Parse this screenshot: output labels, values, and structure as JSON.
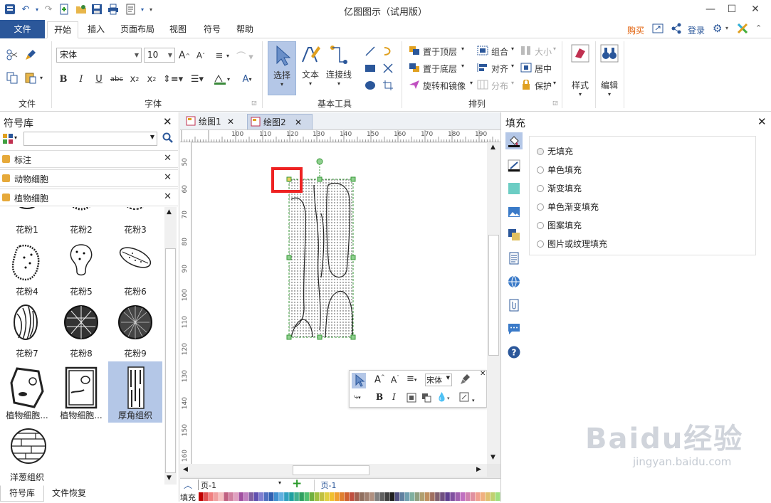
{
  "app": {
    "title": "亿图图示（试用版）"
  },
  "menu_tabs": [
    "文件",
    "开始",
    "插入",
    "页面布局",
    "视图",
    "符号",
    "帮助"
  ],
  "top_right": {
    "buy": "购买",
    "login": "登录"
  },
  "ribbon": {
    "groups": {
      "file": "文件",
      "font": "字体",
      "basic_tools": "基本工具",
      "arrange": "排列"
    },
    "font_name": "宋体",
    "font_size": "10",
    "buttons": {
      "select": "选择",
      "text": "文本",
      "connector": "连接线",
      "bring_front": "置于顶层",
      "send_back": "置于底层",
      "rotate_mirror": "旋转和镜像",
      "group": "组合",
      "align": "对齐",
      "distribute": "分布",
      "size": "大小",
      "center": "居中",
      "protect": "保护",
      "style": "样式",
      "edit": "编辑"
    }
  },
  "left_panel": {
    "title": "符号库",
    "search_placeholder": "",
    "libraries": [
      "标注",
      "动物细胞",
      "植物细胞"
    ],
    "symbols": [
      "花粉1",
      "花粉2",
      "花粉3",
      "花粉4",
      "花粉5",
      "花粉6",
      "花粉7",
      "花粉8",
      "花粉9",
      "植物细胞...",
      "植物细胞...",
      "厚角组织",
      "洋葱组织"
    ],
    "selected_symbol": "厚角组织",
    "bottom_tabs": [
      "符号库",
      "文件恢复"
    ]
  },
  "canvas": {
    "doc_tabs": [
      "绘图1",
      "绘图2"
    ],
    "active_tab": "绘图2",
    "ruler_h": [
      "100",
      "110",
      "120",
      "130",
      "140",
      "150",
      "160",
      "170",
      "180",
      "190"
    ],
    "ruler_v": [
      "50",
      "60",
      "70",
      "80",
      "90",
      "100",
      "110",
      "120",
      "130",
      "140",
      "150",
      "160"
    ],
    "float_toolbar_font": "宋体",
    "page_selector": "页-1",
    "page_tab": "页-1"
  },
  "right_panel": {
    "title": "填充",
    "options": [
      "无填充",
      "单色填充",
      "渐变填充",
      "单色渐变填充",
      "图案填充",
      "图片或纹理填充"
    ],
    "selected": "无填充"
  },
  "status": {
    "fill_label": "填充"
  },
  "watermark": {
    "brand": "Baidu经验",
    "url": "jingyan.baidu.com"
  },
  "colors": {
    "accent": "#2b579a",
    "highlight": "#ee2222",
    "selection": "#b4c7e7",
    "buy": "#e05a00"
  }
}
